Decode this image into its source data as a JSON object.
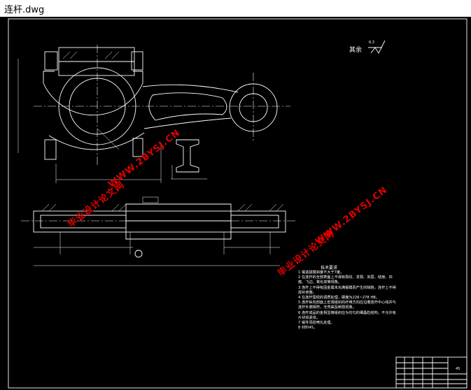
{
  "window": {
    "title": "连杆.dwg"
  },
  "drawing": {
    "surface_finish": {
      "label": "其余",
      "value": "6.3"
    },
    "tech_requirements": {
      "title": "技术要求",
      "items": [
        "1 锻造拔模斜度不大于7度。",
        "2 在连杆的全部表面上不得有裂纹、发裂、夹层、结疤、凹痕、飞边、氧化皮等现象。",
        "3 连杆上不得有因金属未充满锻模而产生的缺陷，连杆上不得焊补修整。",
        "4 在连杆需经的调质处理，硬度为226~278 HB。",
        "5 连杆纵向剖面上宏观组织的纤维方向应沿着连杆中心线并与连杆外廓相符，无弯曲及断裂现象。",
        "6 连杆成品的金相显微组织应为均匀的细晶粒结构，不允许有片状铁素体。",
        "7 锻件须经喷丸处理。",
        "8 材料45。"
      ]
    },
    "scale_note": "45"
  },
  "watermarks": {
    "site": "WWW.2BYSJ.CN",
    "cn": "毕业设计论文网"
  },
  "colors": {
    "background": "#000000",
    "lines": "#ffffff",
    "watermark": "#e00000"
  }
}
